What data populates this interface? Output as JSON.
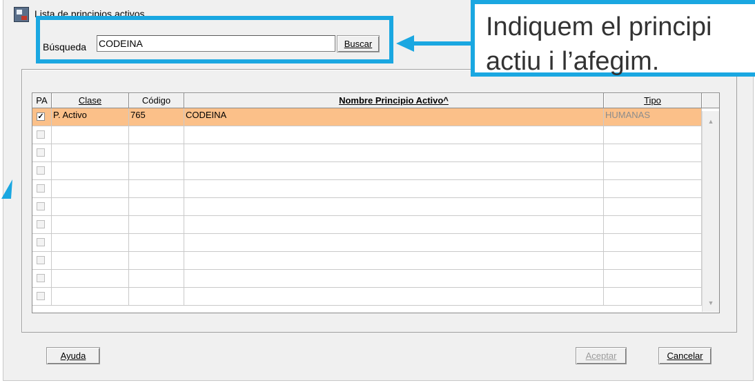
{
  "window": {
    "title": "Lista de principios activos"
  },
  "search": {
    "label": "Búsqueda",
    "value": "CODEINA",
    "button_label": "Buscar"
  },
  "table": {
    "headers": {
      "pa": "PA",
      "clase": "Clase",
      "codigo": "Código",
      "nombre": "Nombre Principio Activo^",
      "tipo": "Tipo"
    },
    "rows": [
      {
        "checked": true,
        "clase": "P. Activo",
        "codigo": "765",
        "nombre": "CODEINA",
        "tipo": "HUMANAS"
      }
    ],
    "empty_rows": 10
  },
  "buttons": {
    "help": "Ayuda",
    "accept": "Aceptar",
    "cancel": "Cancelar"
  },
  "callout": {
    "line1": "Indiquem el principi",
    "line2": "actiu i l’afegim.",
    "color": "#1aa7e1"
  },
  "colors": {
    "selected_row": "#fbc089",
    "dialog_bg": "#f0f0f0",
    "disabled_text": "#9b9b9b"
  }
}
